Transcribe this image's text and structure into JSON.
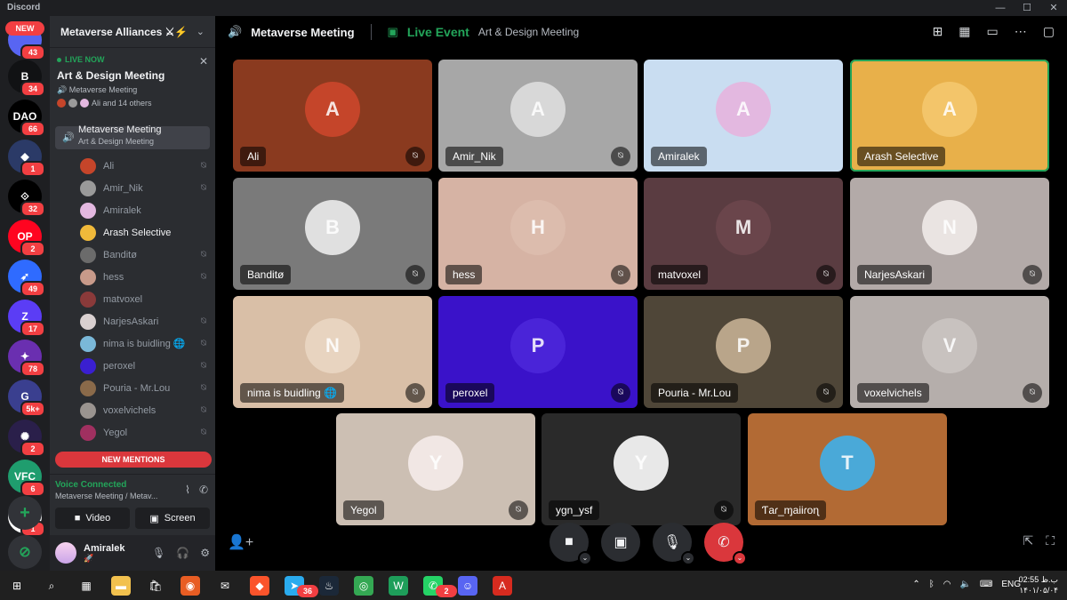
{
  "window": {
    "title": "Discord",
    "controls": [
      "—",
      "☐",
      "✕"
    ]
  },
  "rail": {
    "new_label": "NEW",
    "servers": [
      {
        "label": "",
        "badge": "43",
        "color": "#5865f2"
      },
      {
        "label": "B",
        "badge": "34",
        "color": "#111214"
      },
      {
        "label": "DAO",
        "badge": "66",
        "color": "#000000"
      },
      {
        "label": "◆",
        "badge": "1",
        "color": "#2b3a67"
      },
      {
        "label": "⟐",
        "badge": "32",
        "color": "#000000"
      },
      {
        "label": "OP",
        "badge": "2",
        "color": "#ff0420"
      },
      {
        "label": "➶",
        "badge": "49",
        "color": "#2f6bff"
      },
      {
        "label": "Z",
        "badge": "17",
        "color": "#5b3df5"
      },
      {
        "label": "✦",
        "badge": "78",
        "color": "#6a2fb0"
      },
      {
        "label": "G",
        "badge": "5k+",
        "color": "#3a3f8f"
      },
      {
        "label": "✺",
        "badge": "2",
        "color": "#2a1f4a"
      },
      {
        "label": "VFC",
        "badge": "6",
        "color": "#1f9d6e"
      },
      {
        "label": "▥",
        "badge": "1",
        "color": "#ffffff"
      }
    ],
    "add_icon": "+",
    "explore_icon": "⊘"
  },
  "sidebar": {
    "server_name": "Metaverse Alliances ⚔⚡",
    "live": {
      "label": "LIVE NOW",
      "title": "Art & Design Meeting",
      "channel": "Metaverse Meeting",
      "attendees": "Ali and 14 others"
    },
    "active_channel": {
      "name": "Metaverse Meeting",
      "subtitle": "Art & Design Meeting"
    },
    "members": [
      {
        "name": "Ali",
        "muted": true,
        "color": "#c5452a"
      },
      {
        "name": "Amir_Nik",
        "muted": true,
        "color": "#9a9a9a"
      },
      {
        "name": "Amiralek",
        "muted": false,
        "color": "#e3b8e0"
      },
      {
        "name": "Arash Selective",
        "muted": false,
        "color": "#f0b93a",
        "speaking": true
      },
      {
        "name": "Banditø",
        "muted": true,
        "color": "#6b6b6b"
      },
      {
        "name": "hess",
        "muted": true,
        "color": "#c89a8a"
      },
      {
        "name": "matvoxel",
        "muted": false,
        "color": "#8a3a3a"
      },
      {
        "name": "NarjesAskari",
        "muted": true,
        "color": "#d9d0d0"
      },
      {
        "name": "nima is buidling 🌐",
        "muted": true,
        "color": "#7ab8d8"
      },
      {
        "name": "peroxel",
        "muted": true,
        "color": "#3a1fd0"
      },
      {
        "name": "Pouria - Mr.Lou",
        "muted": true,
        "color": "#8a6a4a"
      },
      {
        "name": "voxelvichels",
        "muted": true,
        "color": "#9a9490"
      },
      {
        "name": "Yegol",
        "muted": true,
        "color": "#a03060"
      }
    ],
    "mentions_label": "NEW MENTIONS",
    "voice": {
      "status": "Voice Connected",
      "location": "Metaverse Meeting / Metav...",
      "video_label": "Video",
      "screen_label": "Screen"
    },
    "user": {
      "name": "Amiralek",
      "status": "🚀"
    }
  },
  "main": {
    "channel": "Metaverse Meeting",
    "live_event_label": "Live Event",
    "event_name": "Art & Design Meeting",
    "tiles": [
      {
        "name": "Ali",
        "bg": "#8a3a1f",
        "av": "#c5452a",
        "initial": "A",
        "muted": true
      },
      {
        "name": "Amir_Nik",
        "bg": "#a7a7a7",
        "av": "#d8d8d8",
        "initial": "A",
        "muted": true
      },
      {
        "name": "Amiralek",
        "bg": "#c9ddf1",
        "av": "#e3b8e0",
        "initial": "A",
        "muted": false
      },
      {
        "name": "Arash Selective",
        "bg": "#e8b04a",
        "av": "#f3c56a",
        "initial": "A",
        "muted": false,
        "speaking": true
      },
      {
        "name": "Banditø",
        "bg": "#7a7a7a",
        "av": "#e0e0e0",
        "initial": "B",
        "muted": true
      },
      {
        "name": "hess",
        "bg": "#d6b3a4",
        "av": "#dcbcad",
        "initial": "H",
        "muted": true
      },
      {
        "name": "matvoxel",
        "bg": "#5a3c41",
        "av": "#6a454b",
        "initial": "M",
        "muted": true
      },
      {
        "name": "NarjesAskari",
        "bg": "#b3aaa8",
        "av": "#eae4e2",
        "initial": "N",
        "muted": true
      },
      {
        "name": "nima is buidling 🌐",
        "bg": "#d9bfa7",
        "av": "#e8d4c0",
        "initial": "N",
        "muted": true
      },
      {
        "name": "peroxel",
        "bg": "#3a12c9",
        "av": "#4a24d8",
        "initial": "P",
        "muted": true
      },
      {
        "name": "Pouria - Mr.Lou",
        "bg": "#4f4638",
        "av": "#b9a58a",
        "initial": "P",
        "muted": true
      },
      {
        "name": "voxelvichels",
        "bg": "#b5aeab",
        "av": "#c8c2bf",
        "initial": "V",
        "muted": true
      },
      {
        "name": "Yegol",
        "bg": "#ccbfb3",
        "av": "#f1e7e4",
        "initial": "Y",
        "muted": true
      },
      {
        "name": "ygn_ysf",
        "bg": "#2a2a2a",
        "av": "#e8e8e8",
        "initial": "Y",
        "muted": true
      },
      {
        "name": "Ƭaɾ_ɱaiiɾoɳ",
        "bg": "#b26a34",
        "av": "#4aa9d8",
        "initial": "T",
        "muted": false
      }
    ]
  },
  "taskbar": {
    "items": [
      {
        "icon": "⊞",
        "color": "#202020",
        "badge": ""
      },
      {
        "icon": "⌕",
        "color": "#202020",
        "badge": ""
      },
      {
        "icon": "▦",
        "color": "#202020",
        "badge": ""
      },
      {
        "icon": "▬",
        "color": "#f2c14e",
        "badge": ""
      },
      {
        "icon": "🛍",
        "color": "#202020",
        "badge": ""
      },
      {
        "icon": "◉",
        "color": "#e85d23",
        "badge": ""
      },
      {
        "icon": "✉",
        "color": "#202020",
        "badge": ""
      },
      {
        "icon": "◆",
        "color": "#fb542b",
        "badge": ""
      },
      {
        "icon": "➤",
        "color": "#2aabee",
        "badge": "36"
      },
      {
        "icon": "♨",
        "color": "#1b2838",
        "badge": ""
      },
      {
        "icon": "◎",
        "color": "#34a853",
        "badge": ""
      },
      {
        "icon": "W",
        "color": "#1e9e5a",
        "badge": ""
      },
      {
        "icon": "✆",
        "color": "#25d366",
        "badge": "2"
      },
      {
        "icon": "☺",
        "color": "#5865f2",
        "badge": ""
      },
      {
        "icon": "A",
        "color": "#d72b1f",
        "badge": ""
      }
    ],
    "lang": "ENG",
    "time": "ب.ظ 02:55",
    "date": "۱۴۰۱/۰۵/۰۴"
  }
}
